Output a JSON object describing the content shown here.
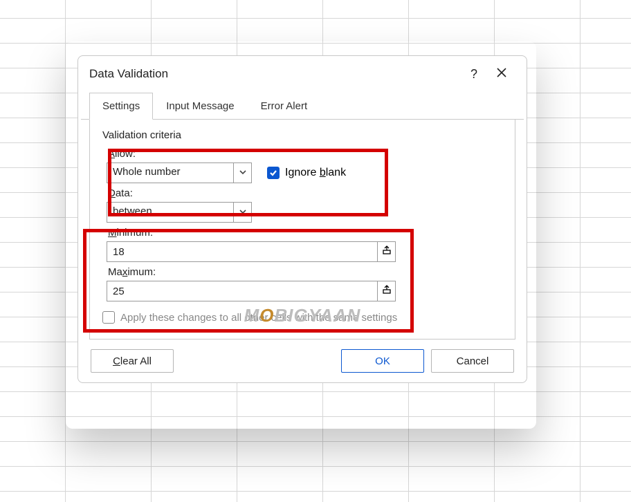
{
  "dialog": {
    "title": "Data Validation",
    "tabs": [
      "Settings",
      "Input Message",
      "Error Alert"
    ],
    "active_tab": 0
  },
  "panel": {
    "section_title": "Validation criteria",
    "allow_label_pre": "A",
    "allow_label_post": "llow:",
    "allow_value": "Whole number",
    "ignore_blank_pre": "Ignore ",
    "ignore_blank_u": "b",
    "ignore_blank_post": "lank",
    "ignore_blank_checked": true,
    "data_label_pre": "D",
    "data_label_post": "ata:",
    "data_value": "between",
    "min_label_pre": "M",
    "min_label_post": "inimum:",
    "min_value": "18",
    "max_label_pre": "Ma",
    "max_label_u": "x",
    "max_label_post": "imum:",
    "max_value": "25",
    "apply_label": "Apply these changes to all other cells with the same settings",
    "apply_checked": false
  },
  "buttons": {
    "clear_pre": "C",
    "clear_post": "lear All",
    "ok": "OK",
    "cancel": "Cancel"
  },
  "watermark": {
    "pre": "M",
    "o": "O",
    "post": "BIGYAAN"
  }
}
